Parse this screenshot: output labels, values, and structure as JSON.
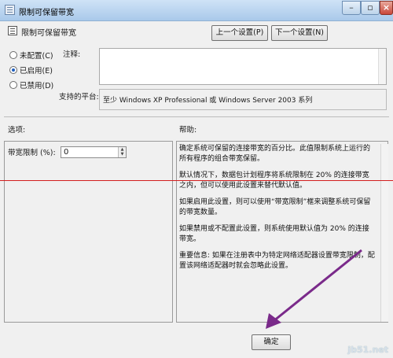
{
  "window": {
    "title": "限制可保留带宽"
  },
  "header": {
    "title": "限制可保留带宽"
  },
  "nav": {
    "prev_label": "上一个设置(P)",
    "next_label": "下一个设置(N)"
  },
  "state": {
    "options": [
      {
        "label": "未配置(C)",
        "selected": false
      },
      {
        "label": "已启用(E)",
        "selected": true
      },
      {
        "label": "已禁用(D)",
        "selected": false
      }
    ]
  },
  "comment": {
    "label": "注释:",
    "value": ""
  },
  "platform": {
    "label": "支持的平台:",
    "value": "至少 Windows XP Professional 或 Windows Server 2003 系列"
  },
  "sections": {
    "options_label": "选项:",
    "help_label": "帮助:"
  },
  "bandwidth": {
    "label": "带宽限制 (%):",
    "value": "0"
  },
  "help": {
    "paragraphs": [
      "确定系统可保留的连接带宽的百分比。此值限制系统上运行的所有程序的组合带宽保留。",
      "默认情况下，数据包计划程序将系统限制在 20% 的连接带宽之内，但可以使用此设置来替代默认值。",
      "如果启用此设置，则可以使用“带宽限制”框来调整系统可保留的带宽数量。",
      "如果禁用或不配置此设置，则系统使用默认值为 20% 的连接带宽。",
      "重要信息: 如果在注册表中为特定网络适配器设置带宽限制，配置该网络适配器时就会忽略此设置。"
    ]
  },
  "footer": {
    "ok_label": "确定"
  },
  "watermark": "jb51.net",
  "colors": {
    "annotation_line": "#d21e1e",
    "annotation_arrow": "#7a2a8a"
  }
}
